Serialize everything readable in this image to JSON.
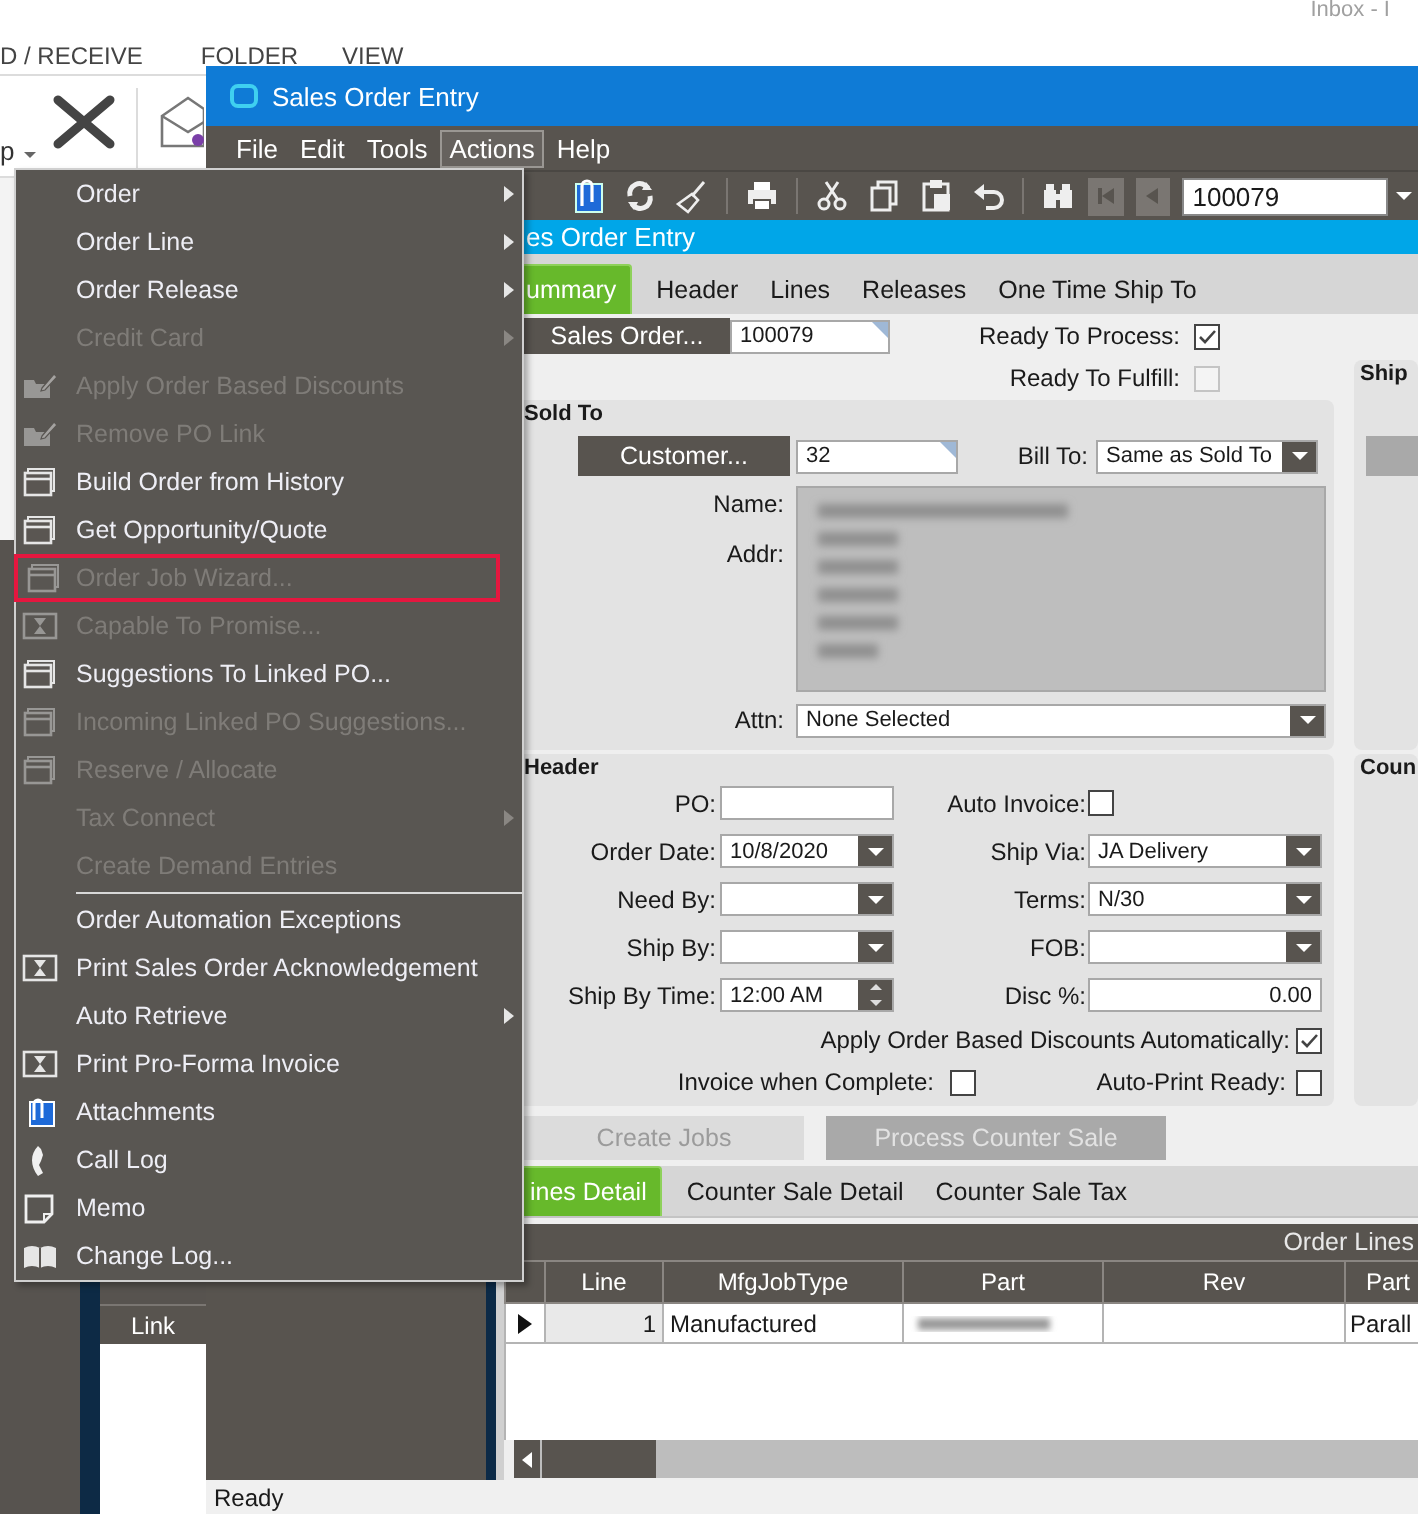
{
  "outlook": {
    "window_title": "Inbox - I",
    "tabs": [
      {
        "label": "D / RECEIVE"
      },
      {
        "label": "FOLDER"
      },
      {
        "label": "VIEW"
      }
    ],
    "ribbon_label": "p",
    "side_column": "Link"
  },
  "window": {
    "title": "Sales Order Entry"
  },
  "menubar": [
    {
      "label": "File",
      "selected": false
    },
    {
      "label": "Edit",
      "selected": false
    },
    {
      "label": "Tools",
      "selected": false
    },
    {
      "label": "Actions",
      "selected": true
    },
    {
      "label": "Help",
      "selected": false
    }
  ],
  "toolbar": {
    "record": "100079"
  },
  "actions_menu": [
    {
      "kind": "plain",
      "label": "Order",
      "disabled": false,
      "submenu": true,
      "highlighted": false
    },
    {
      "kind": "plain",
      "label": "Order Line",
      "disabled": false,
      "submenu": true,
      "highlighted": false
    },
    {
      "kind": "plain",
      "label": "Order Release",
      "disabled": false,
      "submenu": true,
      "highlighted": false
    },
    {
      "kind": "plain",
      "label": "Credit Card",
      "disabled": true,
      "submenu": true,
      "highlighted": false
    },
    {
      "kind": "edit",
      "label": "Apply Order Based Discounts",
      "disabled": true,
      "submenu": false,
      "highlighted": false
    },
    {
      "kind": "edit",
      "label": "Remove PO Link",
      "disabled": true,
      "submenu": false,
      "highlighted": false
    },
    {
      "kind": "window",
      "label": "Build Order from History",
      "disabled": false,
      "submenu": false,
      "highlighted": false
    },
    {
      "kind": "window",
      "label": "Get Opportunity/Quote",
      "disabled": false,
      "submenu": false,
      "highlighted": false
    },
    {
      "kind": "window",
      "label": "Order Job Wizard...",
      "disabled": true,
      "submenu": false,
      "highlighted": true
    },
    {
      "kind": "hourglass",
      "label": "Capable To Promise...",
      "disabled": true,
      "submenu": false,
      "highlighted": false
    },
    {
      "kind": "window",
      "label": "Suggestions To Linked PO...",
      "disabled": false,
      "submenu": false,
      "highlighted": false
    },
    {
      "kind": "window",
      "label": "Incoming Linked PO Suggestions...",
      "disabled": true,
      "submenu": false,
      "highlighted": false
    },
    {
      "kind": "window",
      "label": "Reserve / Allocate",
      "disabled": true,
      "submenu": false,
      "highlighted": false
    },
    {
      "kind": "plain",
      "label": "Tax Connect",
      "disabled": true,
      "submenu": true,
      "highlighted": false
    },
    {
      "kind": "plain",
      "label": "Create Demand Entries",
      "disabled": true,
      "submenu": false,
      "highlighted": false
    },
    {
      "kind": "separator"
    },
    {
      "kind": "plain",
      "label": "Order Automation Exceptions",
      "disabled": false,
      "submenu": false,
      "highlighted": false
    },
    {
      "kind": "hourglass",
      "label": "Print Sales Order Acknowledgement",
      "disabled": false,
      "submenu": false,
      "highlighted": false
    },
    {
      "kind": "plain",
      "label": "Auto Retrieve",
      "disabled": false,
      "submenu": true,
      "highlighted": false
    },
    {
      "kind": "hourglass",
      "label": "Print Pro-Forma Invoice",
      "disabled": false,
      "submenu": false,
      "highlighted": false
    },
    {
      "kind": "attach",
      "label": "Attachments",
      "disabled": false,
      "submenu": false,
      "highlighted": false
    },
    {
      "kind": "phone",
      "label": "Call Log",
      "disabled": false,
      "submenu": false,
      "highlighted": false
    },
    {
      "kind": "memo",
      "label": "Memo",
      "disabled": false,
      "submenu": false,
      "highlighted": false
    },
    {
      "kind": "book",
      "label": "Change Log...",
      "disabled": false,
      "submenu": false,
      "highlighted": false
    }
  ],
  "panel_title": "es Order Entry",
  "tabs": [
    {
      "label": "ummary",
      "selected": true
    },
    {
      "label": "Header",
      "selected": false
    },
    {
      "label": "Lines",
      "selected": false
    },
    {
      "label": "Releases",
      "selected": false
    },
    {
      "label": "One Time Ship To",
      "selected": false
    }
  ],
  "summary": {
    "sales_order_button": "Sales Order...",
    "sales_order": "100079",
    "ready_to_process": {
      "label": "Ready To Process:",
      "checked": true,
      "disabled": false
    },
    "ready_to_fulfill": {
      "label": "Ready To Fulfill:",
      "checked": false,
      "disabled": true
    },
    "sold_to": {
      "title": "Sold To",
      "customer_button": "Customer...",
      "customer": "32",
      "bill_to_label": "Bill To:",
      "bill_to": "Same as Sold To",
      "name_label": "Name:",
      "addr_label": "Addr:",
      "address_blurred": true,
      "attn_label": "Attn:",
      "attn": "None Selected"
    },
    "ship_to": {
      "title": "Ship"
    },
    "header": {
      "title": "Header",
      "left_fields": [
        {
          "kind": "text",
          "label": "PO:"
        },
        {
          "kind": "date",
          "label": "Order Date:",
          "value": "10/8/2020"
        },
        {
          "kind": "date",
          "label": "Need By:"
        },
        {
          "kind": "date",
          "label": "Ship By:"
        },
        {
          "kind": "time",
          "label": "Ship By Time:",
          "value": "12:00 AM"
        }
      ],
      "right_fields": [
        {
          "kind": "checkbox",
          "label": "Auto Invoice:",
          "checked": false
        },
        {
          "kind": "combo",
          "label": "Ship Via:",
          "value": "JA Delivery"
        },
        {
          "kind": "combo",
          "label": "Terms:",
          "value": "N/30"
        },
        {
          "kind": "combo",
          "label": "FOB:"
        },
        {
          "kind": "number",
          "label": "Disc %:",
          "value": "0.00"
        }
      ],
      "apply_discounts": {
        "label": "Apply Order Based Discounts Automatically:",
        "checked": true
      },
      "invoice_when_complete": {
        "label": "Invoice when Complete:",
        "checked": false
      },
      "auto_print_ready": {
        "label": "Auto-Print Ready:",
        "checked": false
      }
    },
    "counter_group": {
      "title": "Coun"
    }
  },
  "buttons": [
    {
      "kind": "light",
      "label": "Create Jobs",
      "disabled": true
    },
    {
      "kind": "grey",
      "label": "Process Counter Sale",
      "disabled": true
    }
  ],
  "lower_tabs": [
    {
      "label": "ines Detail",
      "selected": true
    },
    {
      "label": "Counter Sale Detail",
      "selected": false
    },
    {
      "label": "Counter Sale Tax",
      "selected": false
    }
  ],
  "grid": {
    "title": "Order Lines",
    "columns": [
      "Line",
      "MfgJobType",
      "Part",
      "Rev",
      "Part"
    ],
    "rows": [
      {
        "current": true,
        "line": "1",
        "mfg_job_type": "Manufactured",
        "part_blurred": true,
        "part_d": "Parall"
      }
    ]
  },
  "status_bar": "Ready"
}
